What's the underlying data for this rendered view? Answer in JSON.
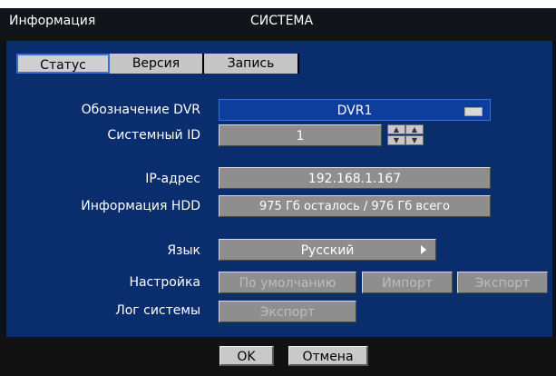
{
  "window": {
    "title_left": "Информация",
    "title_center": "СИСТЕМА"
  },
  "tabs": [
    {
      "label": "Статус",
      "active": true
    },
    {
      "label": "Версия",
      "active": false
    },
    {
      "label": "Запись",
      "active": false
    }
  ],
  "fields": {
    "dvr_name": {
      "label": "Обозначение DVR",
      "value": "DVR1"
    },
    "system_id": {
      "label": "Системный ID",
      "value": "1"
    },
    "ip": {
      "label": "IP-адрес",
      "value": "192.168.1.167"
    },
    "hdd": {
      "label": "Информация HDD",
      "value": "975 Гб осталось / 976 Гб всего"
    },
    "language": {
      "label": "Язык",
      "value": "Русский"
    }
  },
  "settings": {
    "label": "Настройка",
    "buttons": [
      "По умолчанию",
      "Импорт",
      "Экспорт"
    ]
  },
  "syslog": {
    "label": "Лог системы",
    "button": "Экспорт"
  },
  "footer": {
    "ok": "OK",
    "cancel": "Отмена"
  },
  "colors": {
    "panel": "#0a2d6e",
    "field": "#8e8e8e",
    "accent": "#3a6fd8"
  }
}
